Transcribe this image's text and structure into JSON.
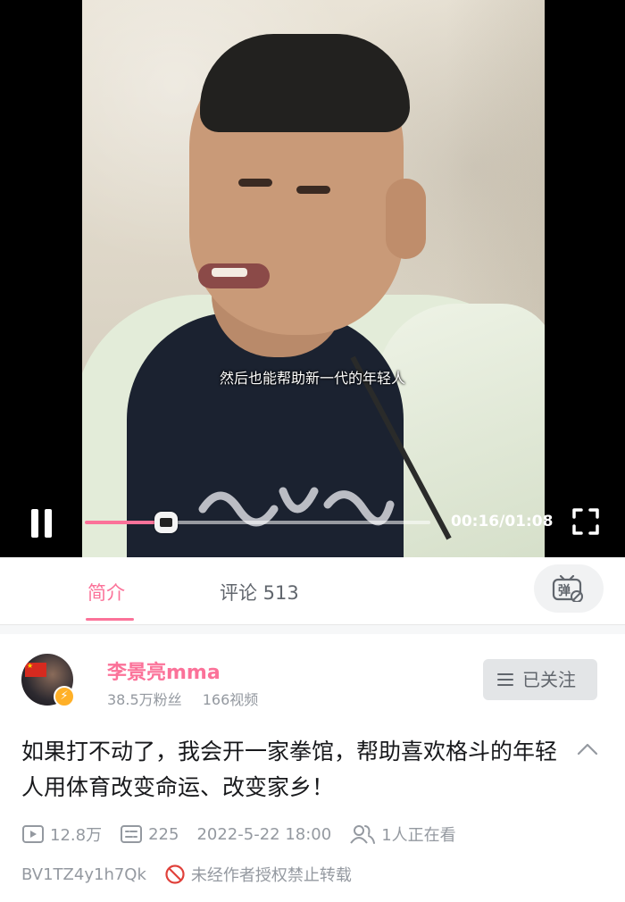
{
  "player": {
    "subtitle": "然后也能帮助新一代的年轻人",
    "time_display": "00:16/01:08",
    "progress_fraction": 0.235,
    "state": "playing"
  },
  "tabs": {
    "intro_label": "简介",
    "comments_label": "评论 513",
    "danmaku_label": "弹",
    "active": "简介"
  },
  "author": {
    "name": "李景亮mma",
    "fans": "38.5万粉丝",
    "videos": "166视频",
    "follow_label": "已关注"
  },
  "video": {
    "title": "如果打不动了，我会开一家拳馆，帮助喜欢格斗的年轻人用体育改变命运、改变家乡！",
    "views": "12.8万",
    "danmaku_count": "225",
    "date": "2022-5-22 18:00",
    "watching": "1人正在看",
    "bvid": "BV1TZ4y1h7Qk",
    "no_repost": "未经作者授权禁止转载"
  },
  "colors": {
    "accent": "#fb7299",
    "muted": "#9499a0",
    "badge": "#ffb027"
  }
}
